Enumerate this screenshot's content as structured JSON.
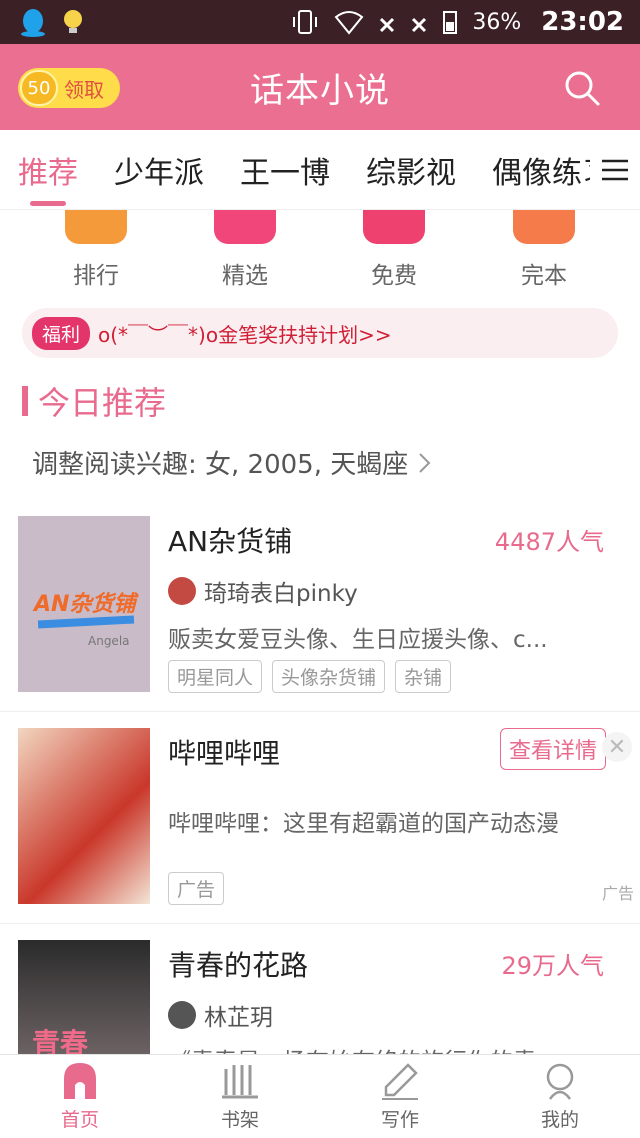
{
  "status_bar": {
    "battery": "36%",
    "time": "23:02"
  },
  "header": {
    "coin_value": "50",
    "coin_label": "领取",
    "title": "话本小说"
  },
  "tabs": [
    {
      "label": "推荐"
    },
    {
      "label": "少年派"
    },
    {
      "label": "王一博"
    },
    {
      "label": "综影视"
    },
    {
      "label": "偶像练习生"
    }
  ],
  "categories": [
    {
      "label": "排行",
      "color": "#f59a3a"
    },
    {
      "label": "精选",
      "color": "#f0467a"
    },
    {
      "label": "免费",
      "color": "#ee4170"
    },
    {
      "label": "完本",
      "color": "#f57b4a"
    }
  ],
  "welfare": {
    "badge": "福利",
    "text": "o(*￣︶￣*)o金笔奖扶持计划>>"
  },
  "section": {
    "title": "今日推荐",
    "interest": "调整阅读兴趣: 女, 2005, 天蝎座"
  },
  "books": [
    {
      "title": "AN杂货铺",
      "popularity": "4487人气",
      "author": "琦琦表白pinky",
      "desc": "贩卖女爱豆头像、生日应援头像、c...",
      "tags": [
        "明星同人",
        "头像杂货铺",
        "杂铺"
      ],
      "cover_text": "AN杂货铺",
      "cover_sub": "Angela"
    },
    {
      "title": "哔哩哔哩",
      "detail_label": "查看详情",
      "desc": "哔哩哔哩：这里有超霸道的国产动态漫",
      "tags": [
        "广告"
      ],
      "ad_mark": "广告"
    },
    {
      "title": "青春的花路",
      "popularity": "29万人气",
      "author": "林芷玥",
      "desc": "《青春是一场有始有终的旅行你的青...",
      "cover_text": "青春"
    }
  ],
  "bottom_nav": [
    {
      "label": "首页"
    },
    {
      "label": "书架"
    },
    {
      "label": "写作"
    },
    {
      "label": "我的"
    }
  ]
}
